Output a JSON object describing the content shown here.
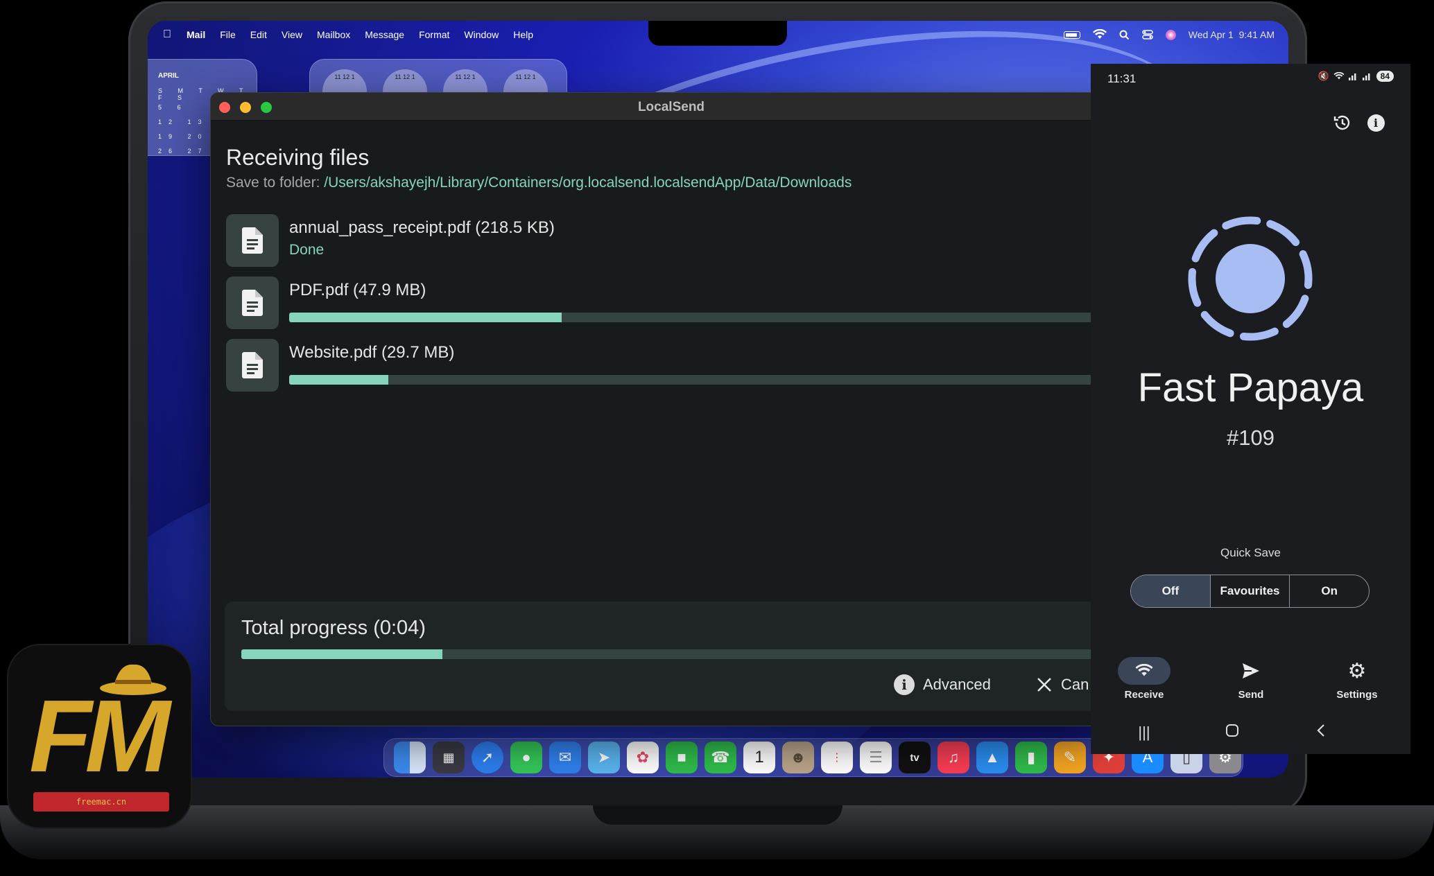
{
  "menubar": {
    "app": "Mail",
    "items": [
      "File",
      "Edit",
      "View",
      "Mailbox",
      "Message",
      "Format",
      "Window",
      "Help"
    ],
    "datetime": "Wed Apr 1  9:41 AM"
  },
  "widgets": {
    "calendar_month": "APRIL",
    "calendar_rows": [
      "S M T W T F S",
      "5 6",
      "12 13",
      "19 20",
      "26 27"
    ],
    "clock_numbers": "11 12 1"
  },
  "localsend": {
    "window_title": "LocalSend",
    "heading": "Receiving files",
    "save_label": "Save to folder: ",
    "save_path": "/Users/akshayejh/Library/Containers/org.localsend.localsendApp/Data/Downloads",
    "files": [
      {
        "name": "annual_pass_receipt.pdf (218.5 KB)",
        "status": "Done",
        "progress": 1.0
      },
      {
        "name": "PDF.pdf (47.9 MB)",
        "status": "",
        "progress": 0.33
      },
      {
        "name": "Website.pdf (29.7 MB)",
        "status": "",
        "progress": 0.12
      }
    ],
    "total_label": "Total progress (0:04)",
    "total_progress": 0.23,
    "advanced_label": "Advanced",
    "cancel_label": "Can"
  },
  "dock": {
    "icons": [
      "finder-icon",
      "launchpad-icon",
      "safari-icon",
      "messages-icon",
      "mail-icon",
      "maps-icon",
      "photos-icon",
      "facetime-icon",
      "phone-icon",
      "calendar-icon",
      "contacts-icon",
      "reminders-icon",
      "notes-icon",
      "tv-icon",
      "music-icon",
      "keynote-icon",
      "numbers-icon",
      "pages-icon",
      "rocket-icon",
      "app-store-icon",
      "preview-icon",
      "system-settings-icon"
    ],
    "calendar_day": "1",
    "tv_label": "tv"
  },
  "phone": {
    "time": "11:31",
    "battery": "84",
    "device_name": "Fast Papaya",
    "device_number": "#109",
    "quick_save_label": "Quick Save",
    "quick_save_options": [
      "Off",
      "Favourites",
      "On"
    ],
    "quick_save_selected": "Off",
    "nav": [
      "Receive",
      "Send",
      "Settings"
    ],
    "nav_active": "Receive"
  },
  "badge": {
    "letters": "FM",
    "site": "freemac.cn"
  },
  "colors": {
    "accent": "#86d4be",
    "track": "#344441",
    "phone_logo": "#a9bdf5",
    "fm_gold": "#d6a72a",
    "fm_red": "#c0272d"
  }
}
